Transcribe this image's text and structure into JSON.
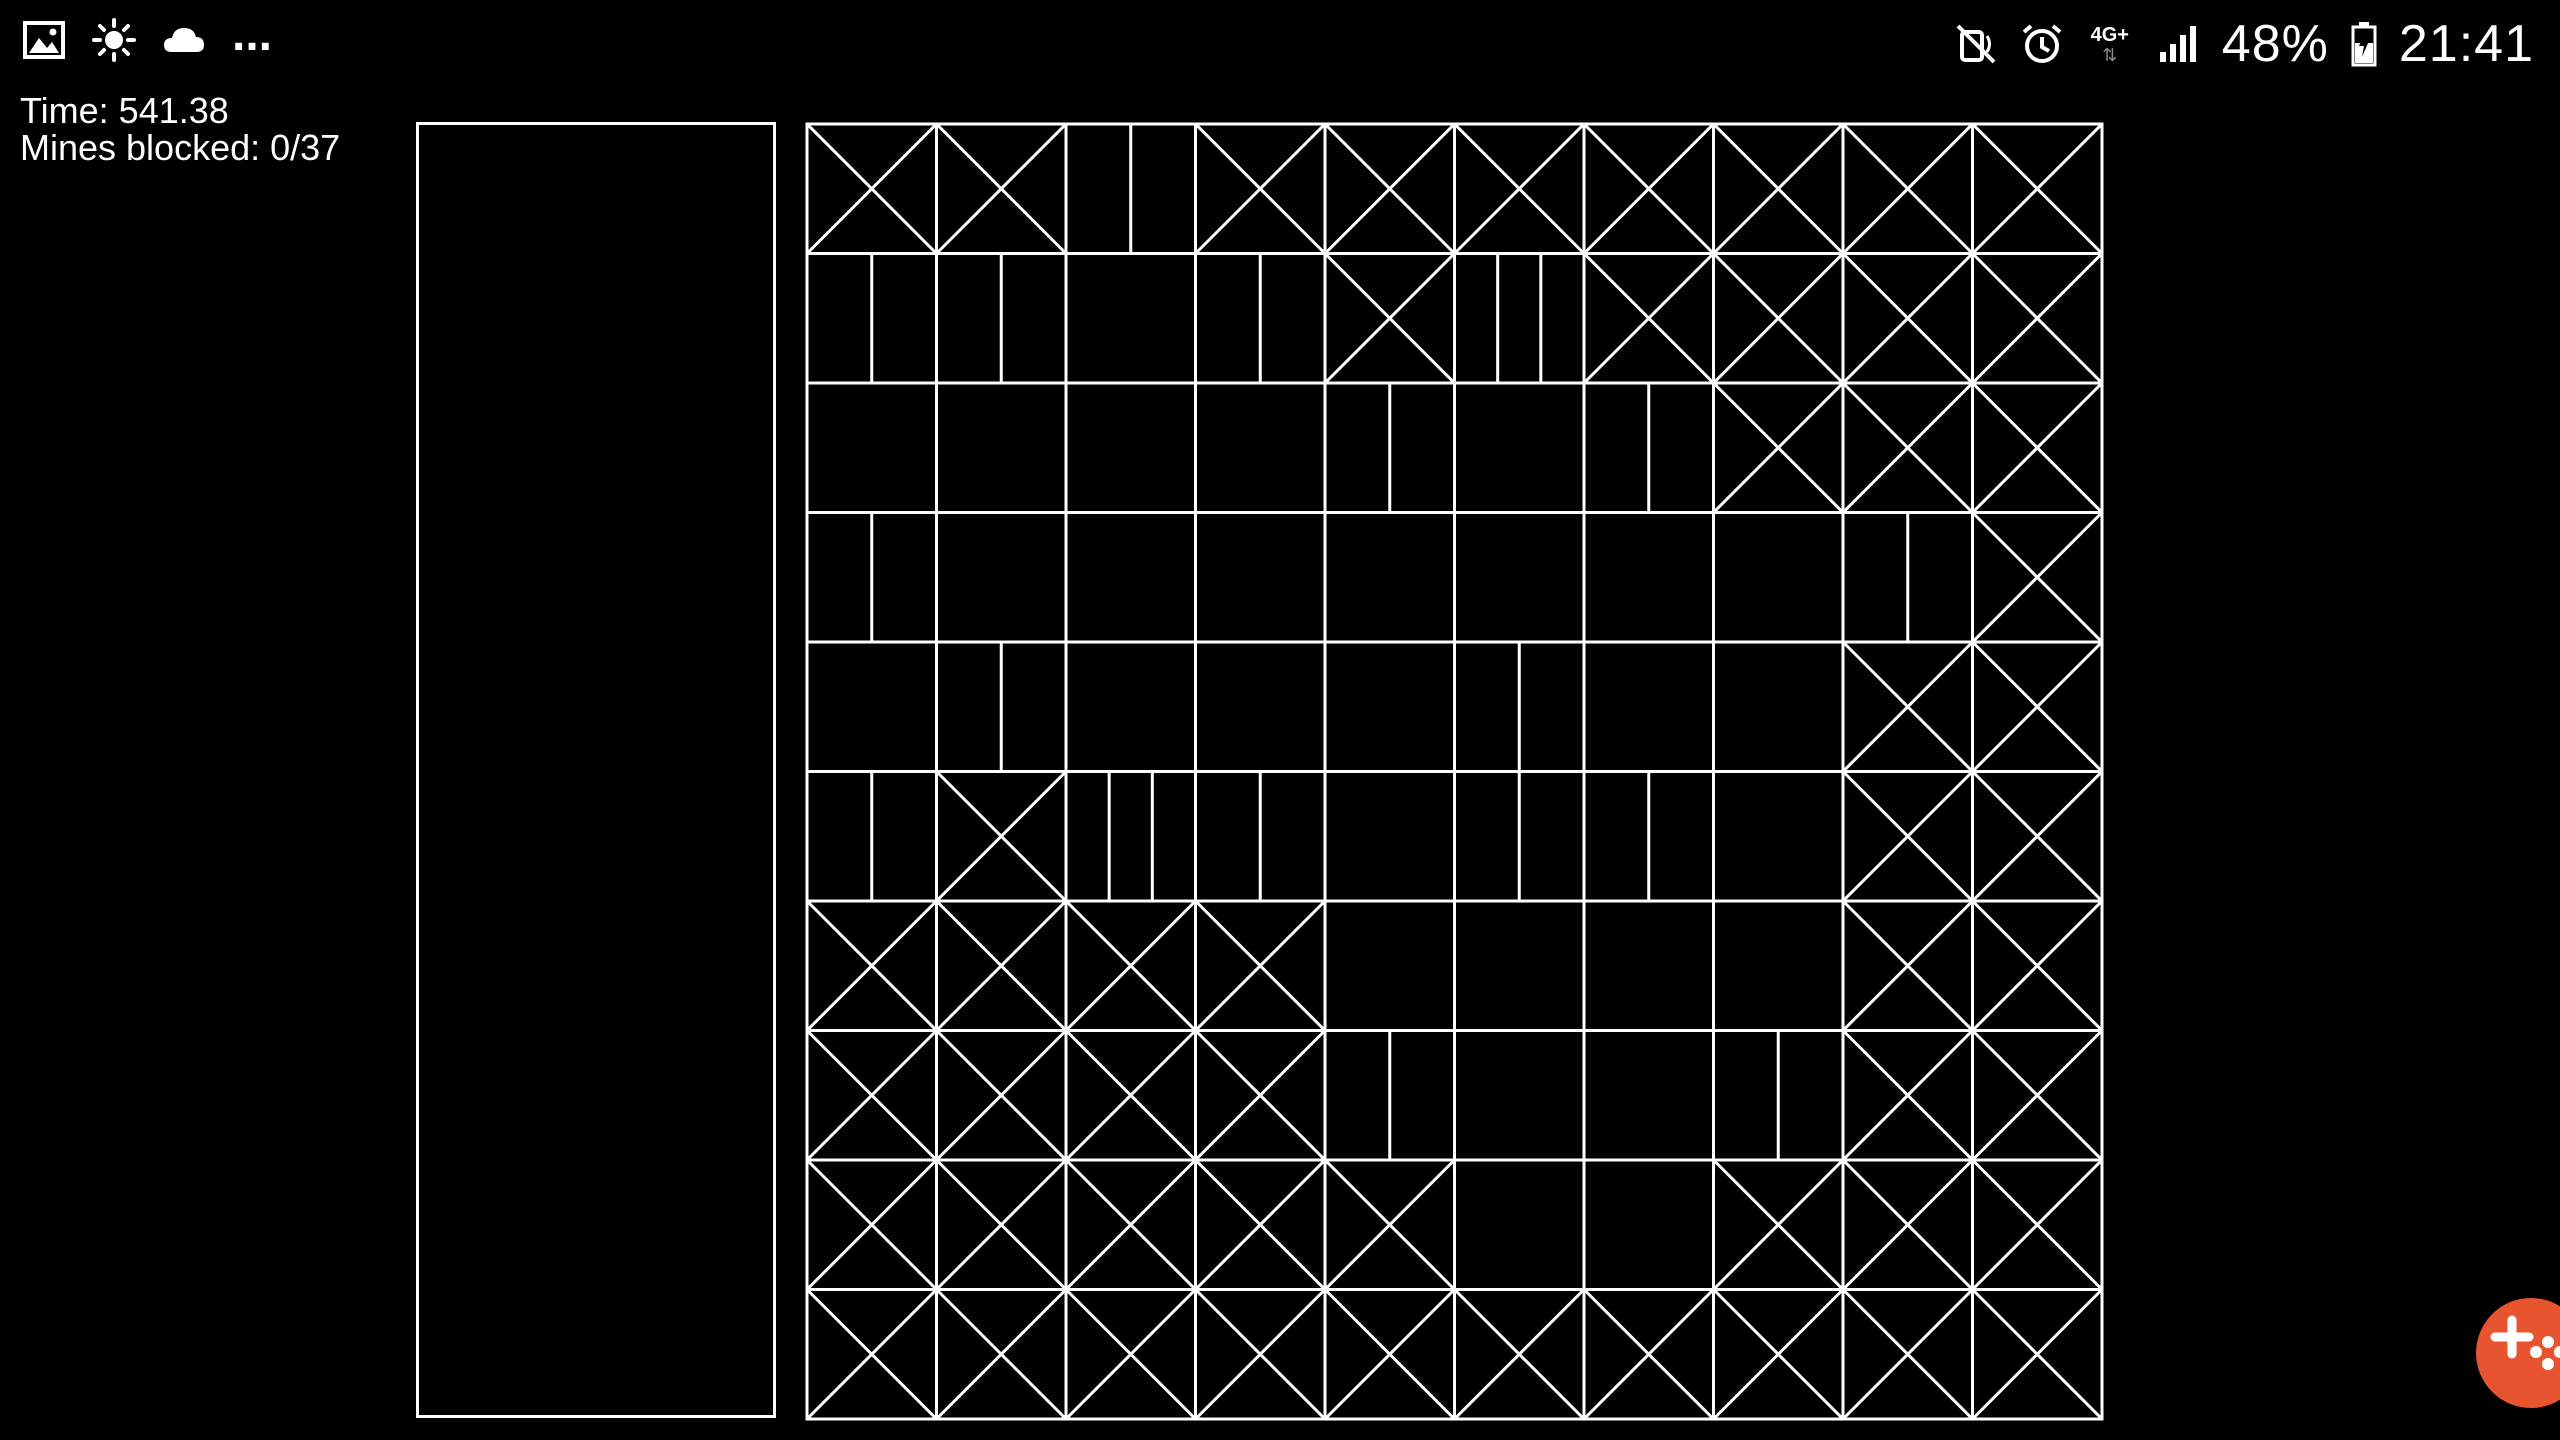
{
  "status_bar": {
    "left_icons": [
      "image-icon",
      "sun-icon",
      "cloud-icon"
    ],
    "overflow": "...",
    "right_icons": [
      "mute-icon",
      "alarm-icon",
      "network-4g-icon",
      "signal-icon"
    ],
    "network_label": "4G+",
    "battery_percent": "48%",
    "clock": "21:41"
  },
  "hud": {
    "time_label": "Time: 541.38",
    "mines_label": "Mines blocked: 0/37"
  },
  "board": {
    "rows": 10,
    "cols": 10,
    "legend": "X = crossed cell, S1 = one vertical stripe, S3 = three stripes, E = empty",
    "cells": [
      [
        "X",
        "X",
        "S1",
        "X",
        "X",
        "X",
        "X",
        "X",
        "X",
        "X"
      ],
      [
        "S1",
        "S1",
        "E",
        "S1",
        "X",
        "S3",
        "X",
        "X",
        "X",
        "X"
      ],
      [
        "E",
        "E",
        "E",
        "E",
        "S1",
        "E",
        "S1",
        "X",
        "X",
        "X"
      ],
      [
        "S1",
        "E",
        "E",
        "E",
        "E",
        "E",
        "E",
        "E",
        "S1",
        "X"
      ],
      [
        "E",
        "S1",
        "E",
        "E",
        "E",
        "S1",
        "E",
        "E",
        "X",
        "X"
      ],
      [
        "S1",
        "X",
        "S3",
        "S1",
        "E",
        "S1",
        "S1",
        "E",
        "X",
        "X"
      ],
      [
        "X",
        "X",
        "X",
        "X",
        "E",
        "E",
        "E",
        "E",
        "X",
        "X"
      ],
      [
        "X",
        "X",
        "X",
        "X",
        "S1",
        "E",
        "E",
        "S1",
        "X",
        "X"
      ],
      [
        "X",
        "X",
        "X",
        "X",
        "X",
        "E",
        "E",
        "X",
        "X",
        "X"
      ],
      [
        "X",
        "X",
        "X",
        "X",
        "X",
        "X",
        "X",
        "X",
        "X",
        "X"
      ]
    ]
  },
  "colors": {
    "background": "#000000",
    "lines": "#ffffff",
    "fab": "#e8542f"
  },
  "fab": {
    "icon": "game-controller-add-icon"
  }
}
